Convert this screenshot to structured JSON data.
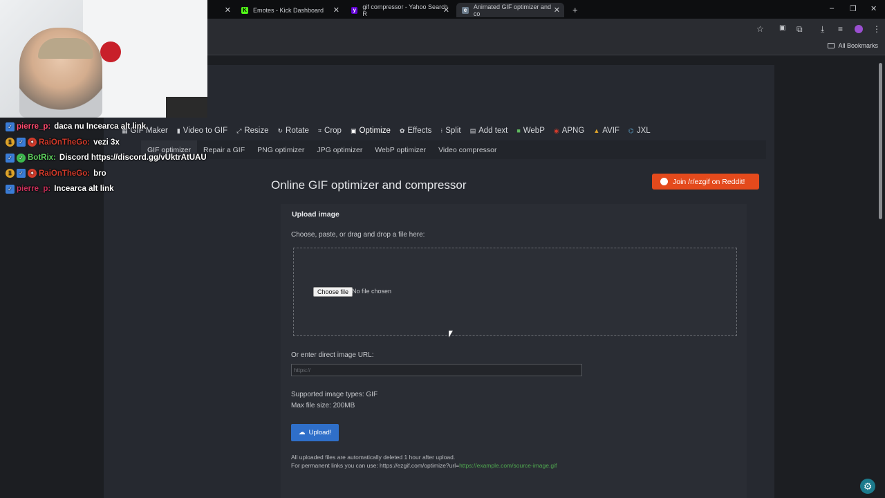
{
  "browser": {
    "tabs": [
      {
        "title": "Emotes - Kick Dashboard",
        "favicon": "kick-icon"
      },
      {
        "title": "gif compressor - Yahoo Search R",
        "favicon": "yahoo-icon"
      },
      {
        "title": "Animated GIF optimizer and co",
        "favicon": "ezgif-icon"
      }
    ],
    "new_tab": "+",
    "window_controls": [
      "–",
      "❐",
      "✕"
    ],
    "all_bookmarks": "All Bookmarks"
  },
  "overlay": {
    "chat": [
      {
        "user": "pierre_p:",
        "message": "daca nu Incearca alt link",
        "badges": [
          "blue"
        ],
        "user_color": "#ff4a6e"
      },
      {
        "user": "RaiOnTheGo:",
        "message": "vezi 3x",
        "badges": [
          "gold",
          "blue",
          "red"
        ],
        "user_color": "#d23b2b"
      },
      {
        "user": "BotRix:",
        "message": "Discord https://discord.gg/vUktrAtUAU",
        "badges": [
          "blue",
          "green"
        ],
        "user_color": "#5ed05e"
      },
      {
        "user": "RaiOnTheGo:",
        "message": "bro",
        "badges": [
          "gold",
          "blue",
          "red"
        ],
        "user_color": "#d23b2b"
      },
      {
        "user": "pierre_p:",
        "message": "Incearca alt link",
        "badges": [
          "blue"
        ],
        "user_color": "#c9305a"
      }
    ]
  },
  "nav": {
    "main": [
      {
        "label": "GIF Maker",
        "icon": "gif-maker-icon"
      },
      {
        "label": "Video to GIF",
        "icon": "video-icon"
      },
      {
        "label": "Resize",
        "icon": "resize-icon"
      },
      {
        "label": "Rotate",
        "icon": "rotate-icon"
      },
      {
        "label": "Crop",
        "icon": "crop-icon"
      },
      {
        "label": "Optimize",
        "icon": "optimize-icon"
      },
      {
        "label": "Effects",
        "icon": "effects-icon"
      },
      {
        "label": "Split",
        "icon": "split-icon"
      },
      {
        "label": "Add text",
        "icon": "add-text-icon"
      },
      {
        "label": "WebP",
        "icon": "webp-icon"
      },
      {
        "label": "APNG",
        "icon": "apng-icon"
      },
      {
        "label": "AVIF",
        "icon": "avif-icon"
      },
      {
        "label": "JXL",
        "icon": "jxl-icon"
      }
    ],
    "sub": [
      "GIF optimizer",
      "Repair a GIF",
      "PNG optimizer",
      "JPG optimizer",
      "WebP optimizer",
      "Video compressor"
    ]
  },
  "main": {
    "title": "Online GIF optimizer and compressor",
    "reddit_button": "Join /r/ezgif on Reddit!",
    "upload_heading": "Upload image",
    "choose_label": "Choose, paste, or drag and drop a file here:",
    "choose_file_button": "Choose file",
    "no_file": "No file chosen",
    "url_label": "Or enter direct image URL:",
    "url_placeholder": "https://",
    "supported_types": "Supported image types: GIF",
    "max_size": "Max file size: 200MB",
    "upload_button": "Upload!",
    "note_delete": "All uploaded files are automatically deleted 1 hour after upload.",
    "note_permanent_prefix": "For permanent links you can use: https://ezgif.com/optimize?url=",
    "note_permanent_example": "https://example.com/source-image.gif"
  },
  "colors": {
    "accent_reddit": "#e44a1c",
    "upload_blue": "#2f6fc9",
    "link_green": "#4fa84f"
  }
}
